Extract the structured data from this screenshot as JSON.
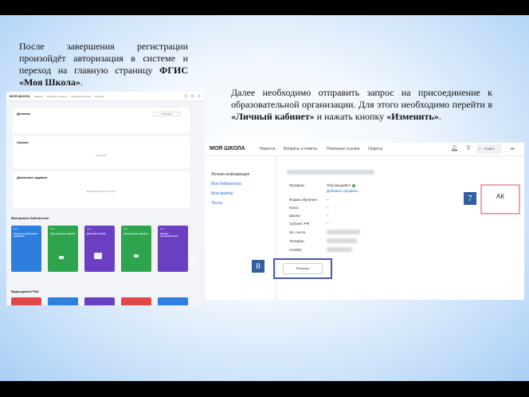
{
  "paragraph1": {
    "prefix": "После завершения регистрации произойдёт авторизация в системе и переход на главную страницу ",
    "bold": "ФГИС «Моя Школа»",
    "suffix": "."
  },
  "paragraph2": {
    "part1": "Далее необходимо отправить запрос на присоединение к образовательной организации. Для этого необходимо перейти в ",
    "bold1": "«Личный кабинет»",
    "part2": " и нажать кнопку ",
    "bold2": "«Изменить»",
    "part3": "."
  },
  "shot1": {
    "logo": "МОЯ ШКОЛА",
    "nav": [
      "Новости",
      "Вопросы и ответы",
      "Полезные ссылки",
      "Опросы"
    ],
    "diary_title": "Дневник",
    "diary_date": "01.09–2023",
    "grades_title": "Оценки",
    "grades_empty": "Оценок нет",
    "homework_title": "Домашние задания",
    "homework_empty": "Домашнее задание отсутствует",
    "library_title": "Материалы библиотеки",
    "library_tiles": [
      {
        "tag": "Урок",
        "title": "Основы и ограничения правления"
      },
      {
        "tag": "Урок",
        "title": "Урок реального задания"
      },
      {
        "tag": "Урок",
        "title": "Двоичная система"
      },
      {
        "tag": "Урок",
        "title": "Элементарные функции"
      },
      {
        "tag": "Урок",
        "title": "Основы алгоритмических"
      }
    ],
    "video_title": "Видеоуроки РЭШ",
    "arrow": "›"
  },
  "shot2": {
    "logo": "МОЯ ШКОЛА",
    "nav": [
      "Новости",
      "Вопросы и ответы",
      "Полезные ссылки",
      "Опросы"
    ],
    "search_label": "Поиск",
    "avatar_small": "АК",
    "side_items": [
      "Личная информация",
      "Моя библиотека",
      "Мои файлы",
      "Тесты"
    ],
    "labels": [
      "Профиль",
      "Форма обучения",
      "Класс",
      "Школа",
      "Субъект РФ",
      "Эл. почта",
      "Телефон",
      "СНИЛС"
    ],
    "profile_value": "Обучающийся",
    "add_profile": "Добавить профиль",
    "dash": "–",
    "edit_button": "Изменить"
  },
  "avatar_highlight": "АК",
  "badges": {
    "b7": "7",
    "b8": "8"
  },
  "colors": {
    "badge": "#315f9f",
    "edit_highlight": "#4659c2",
    "avatar_highlight": "#e9a6ad",
    "link": "#2b6dd8"
  }
}
